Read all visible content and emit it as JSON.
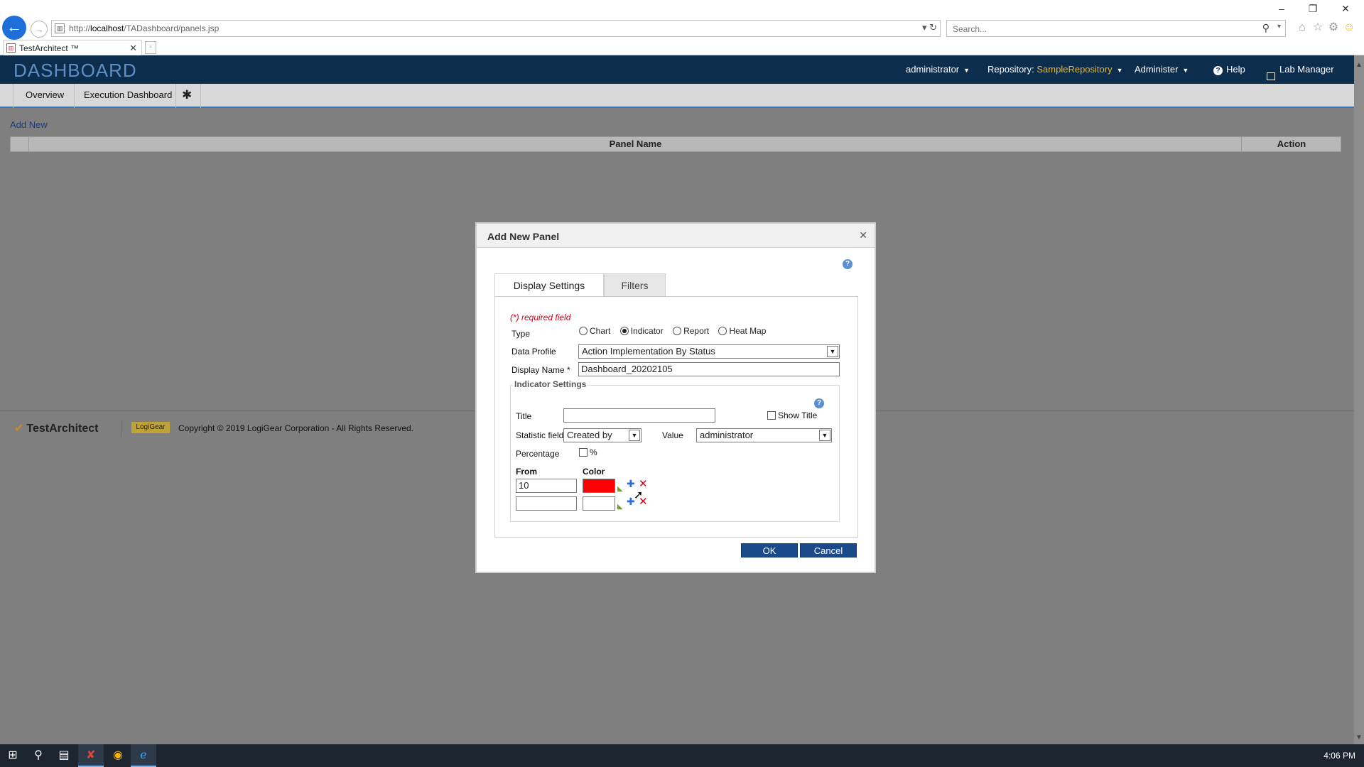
{
  "browser": {
    "url_prefix": "http://",
    "url_host": "localhost",
    "url_path": "/TADashboard/panels.jsp",
    "search_placeholder": "Search...",
    "tab_title": "TestArchitect ™",
    "window_controls": {
      "minimize": "–",
      "restore": "❐",
      "close": "✕"
    }
  },
  "header": {
    "logo": "DASHBOARD",
    "user": "administrator",
    "repository_label": "Repository:",
    "repository_name": "SampleRepository",
    "administer": "Administer",
    "help": "Help",
    "lab_manager": "Lab Manager"
  },
  "nav": {
    "items": [
      "Overview",
      "Execution Dashboard"
    ]
  },
  "page": {
    "add_new": "Add New",
    "columns": {
      "panel_name": "Panel Name",
      "action": "Action"
    }
  },
  "footer": {
    "brand": "TestArchitect",
    "logigear": "LogiGear",
    "copyright": "Copyright © 2019 LogiGear Corporation - All Rights Reserved."
  },
  "modal": {
    "title": "Add New Panel",
    "tabs": [
      "Display Settings",
      "Filters"
    ],
    "required_note": "(*) required field",
    "type_label": "Type",
    "type_options": [
      "Chart",
      "Indicator",
      "Report",
      "Heat Map"
    ],
    "type_selected": "Indicator",
    "data_profile_label": "Data Profile",
    "data_profile_value": "Action Implementation By Status",
    "display_name_label": "Display Name *",
    "display_name_value": "Dashboard_20202105",
    "indicator_settings_label": "Indicator Settings",
    "title_label": "Title",
    "title_value": "",
    "show_title_label": "Show Title",
    "statistic_field_label": "Statistic field *",
    "statistic_field_value": "Created by",
    "value_label": "Value",
    "value_value": "administrator",
    "percentage_label": "Percentage",
    "percent_symbol": "%",
    "from_label": "From",
    "color_label": "Color",
    "rows": [
      {
        "from": "10",
        "color": "#ff0000"
      },
      {
        "from": "",
        "color": "#ffffff"
      }
    ],
    "ok": "OK",
    "cancel": "Cancel"
  },
  "taskbar": {
    "time": "4:06 PM"
  }
}
